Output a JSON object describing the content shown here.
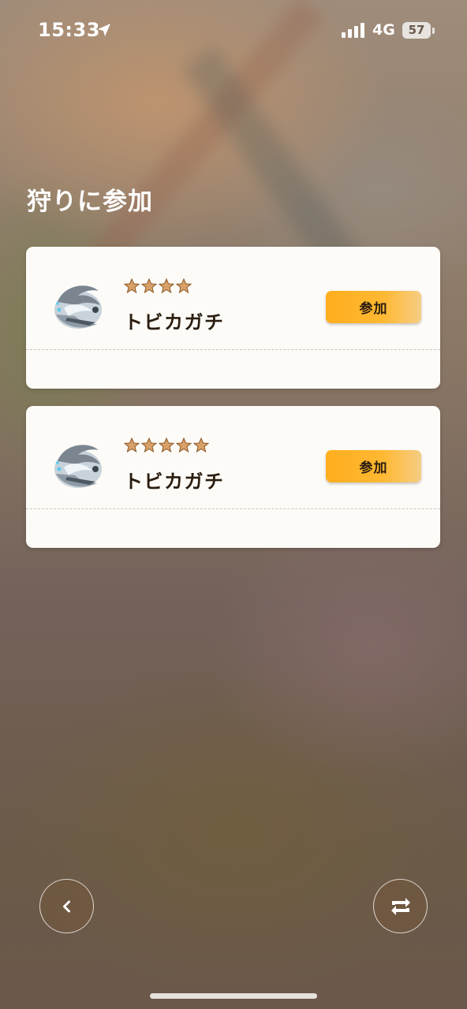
{
  "status_bar": {
    "time": "15:33",
    "network": "4G",
    "battery": "57"
  },
  "page": {
    "title": "狩りに参加"
  },
  "hunts": [
    {
      "name": "トビカガチ",
      "stars": 4,
      "join_label": "参加",
      "icon": "tobikagachi-icon"
    },
    {
      "name": "トビカガチ",
      "stars": 5,
      "join_label": "参加",
      "icon": "tobikagachi-icon"
    }
  ],
  "nav": {
    "back_icon": "chevron-left-icon",
    "refresh_icon": "swap-arrows-icon"
  },
  "colors": {
    "accent": "#ffae1e",
    "star": "#d9a068",
    "text_dark": "#2a1d10"
  }
}
